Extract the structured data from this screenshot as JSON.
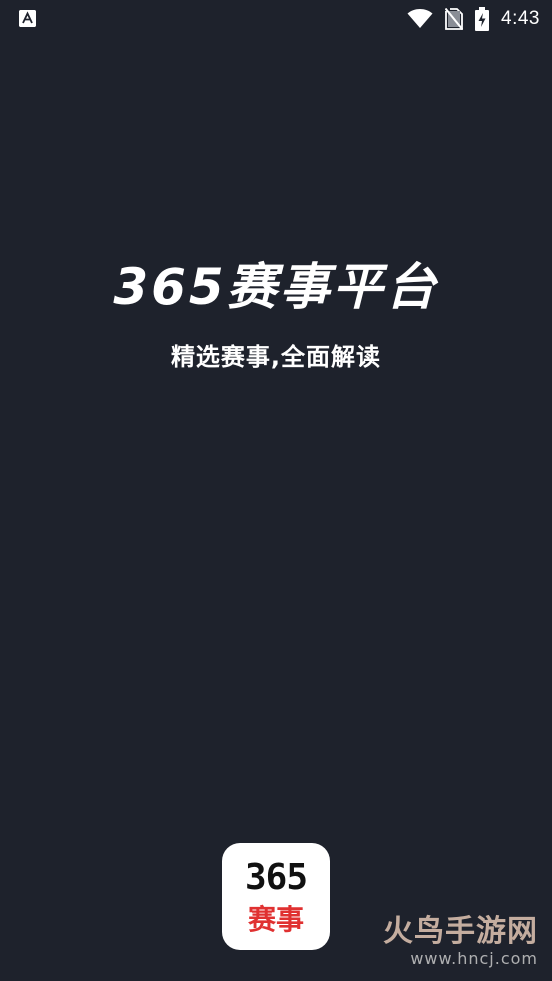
{
  "status_bar": {
    "time": "4:43",
    "icons": [
      "app-notification-icon",
      "wifi-icon",
      "no-sim-icon",
      "battery-charging-icon"
    ]
  },
  "splash": {
    "title": "365赛事平台",
    "subtitle": "精选赛事,全面解读"
  },
  "app_logo": {
    "number": "365",
    "name": "赛事",
    "colors": {
      "number": "#111111",
      "name": "#e03131",
      "background": "#ffffff"
    }
  },
  "watermark": {
    "site_name": "火鸟手游网",
    "url": "www.hncj.com"
  },
  "colors": {
    "background": "#1e222c",
    "text": "#ffffff"
  }
}
